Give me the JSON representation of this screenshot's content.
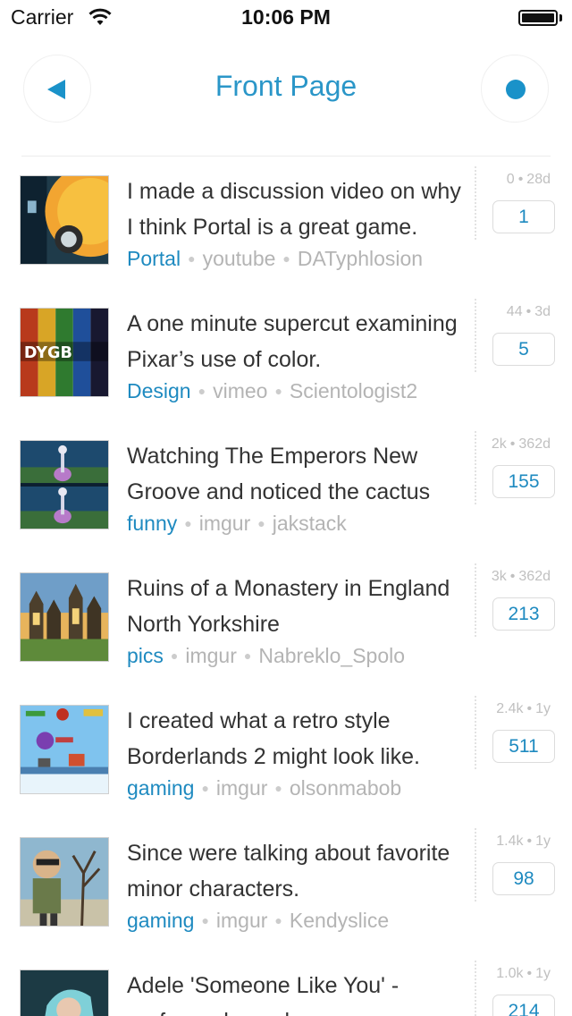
{
  "status_bar": {
    "carrier": "Carrier",
    "time": "10:06 PM",
    "wifi_icon": "wifi-icon",
    "battery_icon": "battery-icon"
  },
  "nav": {
    "title": "Front Page",
    "back_icon": "back-triangle-icon",
    "action_icon": "dot-icon"
  },
  "colors": {
    "accent": "#2a96c8",
    "subreddit": "#1e8ac0",
    "meta_gray": "#b4b4b4"
  },
  "stories": [
    {
      "title": "I made a discussion video on why I think Portal is a great game.",
      "subreddit": "Portal",
      "domain": "youtube",
      "author": "DATyphlosion",
      "score": "0",
      "age": "28d",
      "comments": "1"
    },
    {
      "title": "A one minute supercut examining Pixar’s use of color.",
      "subreddit": "Design",
      "domain": "vimeo",
      "author": "Scientologist2",
      "score": "44",
      "age": "3d",
      "comments": "5"
    },
    {
      "title": "Watching The Emperors New Groove and noticed the cactus",
      "subreddit": "funny",
      "domain": "imgur",
      "author": "jakstack",
      "score": "2k",
      "age": "362d",
      "comments": "155"
    },
    {
      "title": "Ruins of a Monastery in England North Yorkshire",
      "subreddit": "pics",
      "domain": "imgur",
      "author": "Nabreklo_Spolo",
      "score": "3k",
      "age": "362d",
      "comments": "213"
    },
    {
      "title": "I created what a retro style Borderlands 2 might look like.",
      "subreddit": "gaming",
      "domain": "imgur",
      "author": "olsonmabob",
      "score": "2.4k",
      "age": "1y",
      "comments": "511"
    },
    {
      "title": "Since were talking about favorite minor characters.",
      "subreddit": "gaming",
      "domain": "imgur",
      "author": "Kendyslice",
      "score": "1.4k",
      "age": "1y",
      "comments": "98"
    },
    {
      "title": "Adele 'Someone Like You' - performed on a bass",
      "subreddit": "",
      "domain": "",
      "author": "",
      "score": "1.0k",
      "age": "1y",
      "comments": "214"
    }
  ]
}
